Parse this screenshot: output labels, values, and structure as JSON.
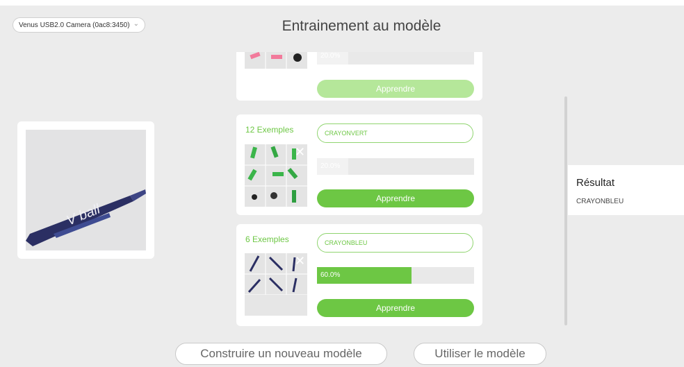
{
  "camera_select": {
    "value": "Venus USB2.0 Camera (0ac8:3450)",
    "icon": "chevron-down-icon"
  },
  "page_title": "Entrainement au modèle",
  "classes": [
    {
      "count_label": "",
      "name": "",
      "progress": 0.2,
      "progress_text": "20.0%",
      "learn_label": "Apprendre",
      "button_state": "disabled"
    },
    {
      "count_label": "12 Exemples",
      "name": "CRAYONVERT",
      "progress": 0.2,
      "progress_text": "20.0%",
      "learn_label": "Apprendre",
      "button_state": "enabled"
    },
    {
      "count_label": "6 Exemples",
      "name": "CRAYONBLEU",
      "progress": 0.6,
      "progress_text": "60.0%",
      "learn_label": "Apprendre",
      "button_state": "enabled"
    }
  ],
  "result": {
    "title": "Résultat",
    "value": "CRAYONBLEU"
  },
  "buttons": {
    "build_new_model": "Construire un nouveau modèle",
    "use_model": "Utiliser le modèle"
  },
  "colors": {
    "accent": "#6dc744",
    "accent_light": "#b5e79a",
    "track": "#e9e9e9",
    "background": "#ececec"
  }
}
